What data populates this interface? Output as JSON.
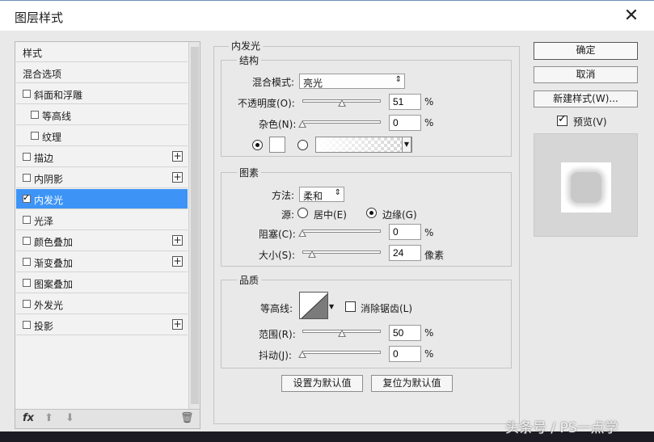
{
  "window": {
    "title": "图层样式",
    "close_glyph": "✕"
  },
  "left_list": {
    "items": [
      {
        "label": "样式",
        "has_checkbox": false,
        "checked": false,
        "has_plus": false,
        "indent": false,
        "selected": false
      },
      {
        "label": "混合选项",
        "has_checkbox": false,
        "checked": false,
        "has_plus": false,
        "indent": false,
        "selected": false
      },
      {
        "label": "斜面和浮雕",
        "has_checkbox": true,
        "checked": false,
        "has_plus": false,
        "indent": false,
        "selected": false
      },
      {
        "label": "等高线",
        "has_checkbox": true,
        "checked": false,
        "has_plus": false,
        "indent": true,
        "selected": false
      },
      {
        "label": "纹理",
        "has_checkbox": true,
        "checked": false,
        "has_plus": false,
        "indent": true,
        "selected": false
      },
      {
        "label": "描边",
        "has_checkbox": true,
        "checked": false,
        "has_plus": true,
        "indent": false,
        "selected": false
      },
      {
        "label": "内阴影",
        "has_checkbox": true,
        "checked": false,
        "has_plus": true,
        "indent": false,
        "selected": false
      },
      {
        "label": "内发光",
        "has_checkbox": true,
        "checked": true,
        "has_plus": false,
        "indent": false,
        "selected": true
      },
      {
        "label": "光泽",
        "has_checkbox": true,
        "checked": false,
        "has_plus": false,
        "indent": false,
        "selected": false
      },
      {
        "label": "颜色叠加",
        "has_checkbox": true,
        "checked": false,
        "has_plus": true,
        "indent": false,
        "selected": false
      },
      {
        "label": "渐变叠加",
        "has_checkbox": true,
        "checked": false,
        "has_plus": true,
        "indent": false,
        "selected": false
      },
      {
        "label": "图案叠加",
        "has_checkbox": true,
        "checked": false,
        "has_plus": false,
        "indent": false,
        "selected": false
      },
      {
        "label": "外发光",
        "has_checkbox": true,
        "checked": false,
        "has_plus": false,
        "indent": false,
        "selected": false
      },
      {
        "label": "投影",
        "has_checkbox": true,
        "checked": false,
        "has_plus": true,
        "indent": false,
        "selected": false
      }
    ],
    "toolbar": {
      "fx_label": "fx",
      "up_glyph": "⬆",
      "down_glyph": "⬇",
      "trash_glyph": "🗑"
    }
  },
  "panel": {
    "title": "内发光",
    "structure": {
      "legend": "结构",
      "blend_mode_label": "混合模式:",
      "blend_mode_value": "亮光",
      "opacity_label": "不透明度(O):",
      "opacity_value": "51",
      "opacity_percent": 51,
      "noise_label": "杂色(N):",
      "noise_value": "0",
      "noise_percent": 0,
      "unit_percent": "%"
    },
    "elements": {
      "legend": "图素",
      "method_label": "方法:",
      "method_value": "柔和",
      "source_label": "源:",
      "source_center": "居中(E)",
      "source_edge": "边缘(G)",
      "choke_label": "阻塞(C):",
      "choke_value": "0",
      "choke_percent": 0,
      "size_label": "大小(S):",
      "size_value": "24",
      "size_fraction": 0.12,
      "size_unit": "像素",
      "unit_percent": "%"
    },
    "quality": {
      "legend": "品质",
      "contour_label": "等高线:",
      "antialias_label": "消除锯齿(L)",
      "range_label": "范围(R):",
      "range_value": "50",
      "range_percent": 50,
      "jitter_label": "抖动(J):",
      "jitter_value": "0",
      "jitter_percent": 0,
      "unit_percent": "%"
    },
    "buttons": {
      "make_default": "设置为默认值",
      "reset_default": "复位为默认值"
    }
  },
  "right": {
    "ok": "确定",
    "cancel": "取消",
    "new_style": "新建样式(W)...",
    "preview_label": "预览(V)",
    "preview_checked": true
  },
  "watermark": "头条号 / PS一点学",
  "colors": {
    "selection": "#3d94f6",
    "background": "#e9e9e9"
  }
}
